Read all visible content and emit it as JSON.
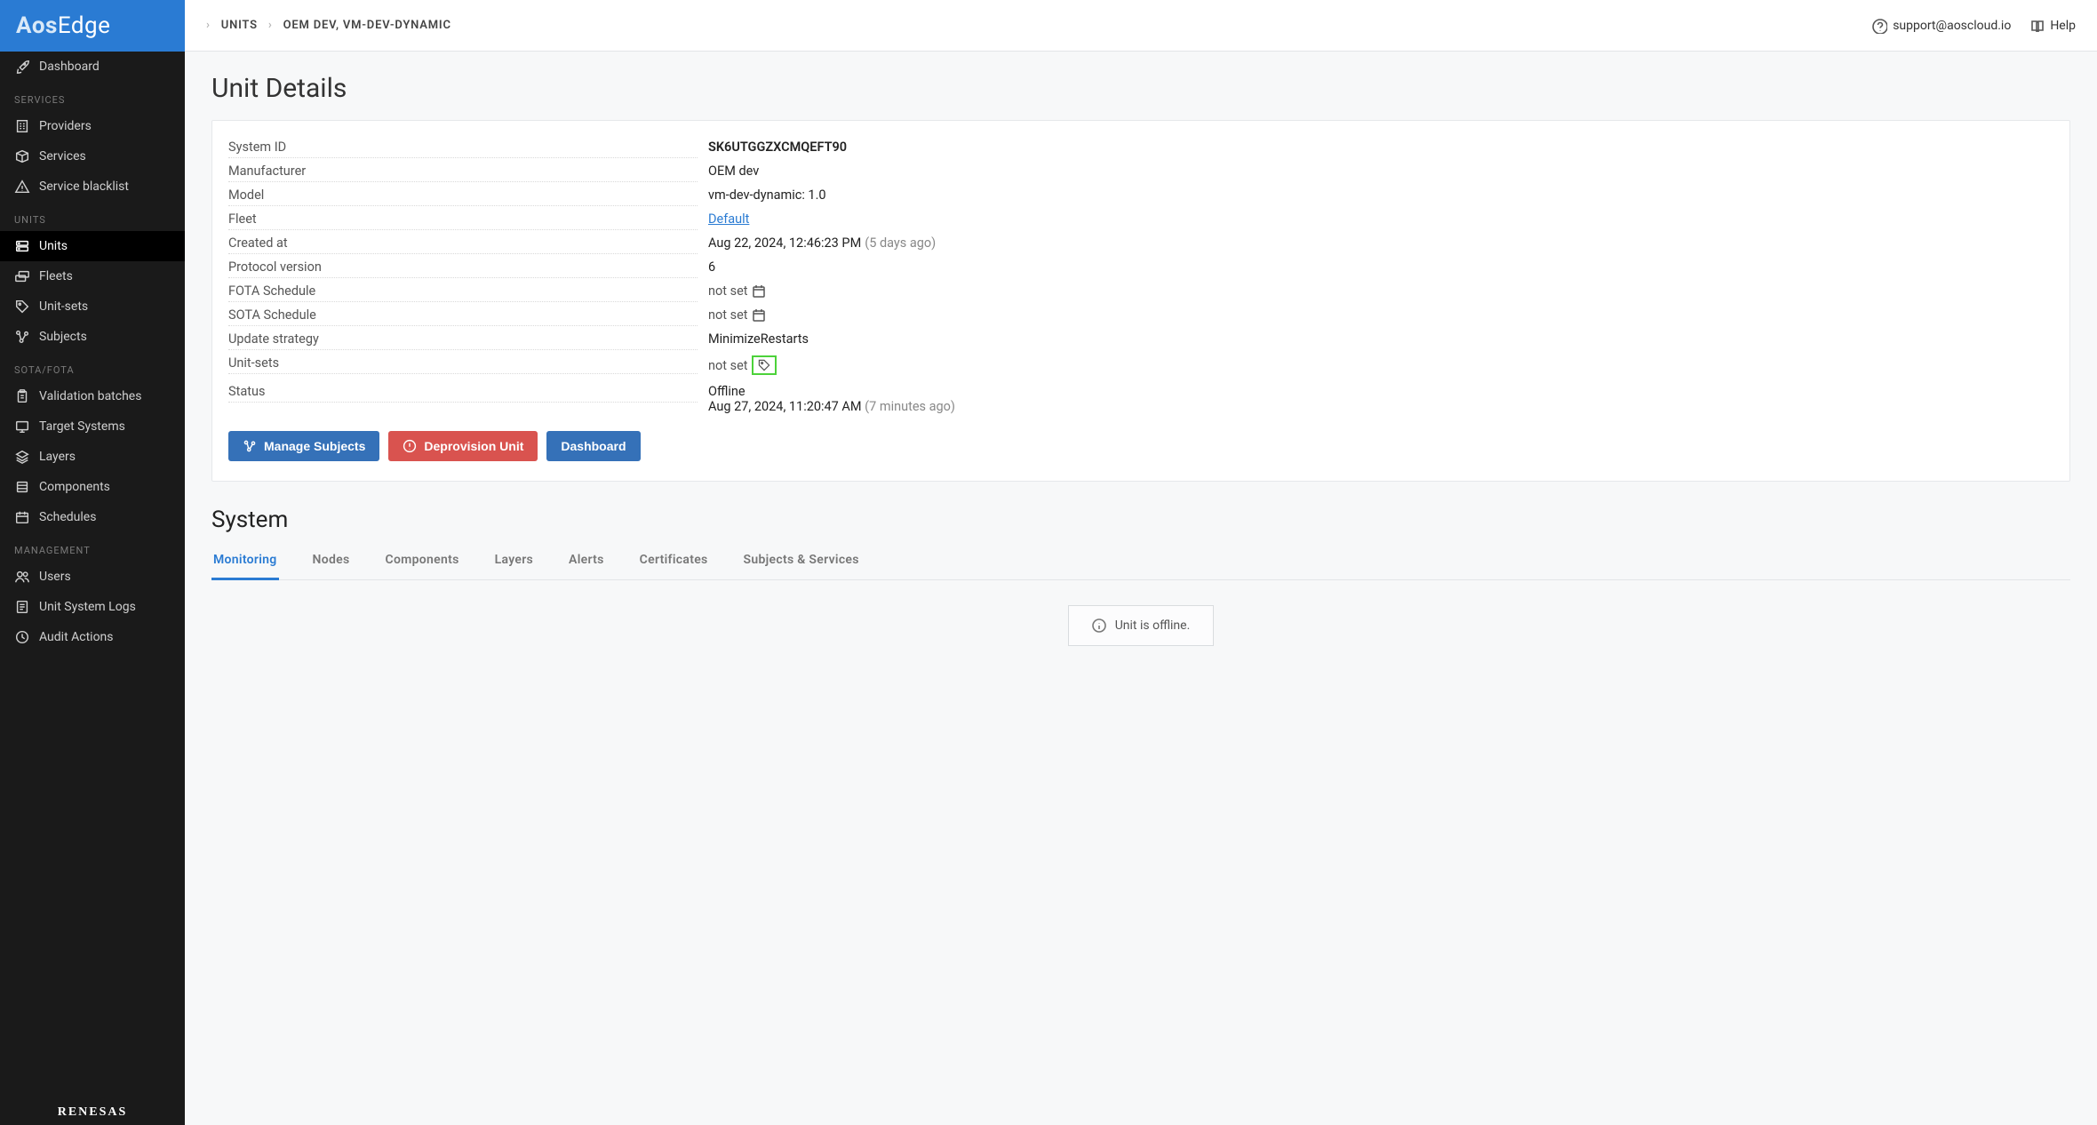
{
  "app": {
    "logo1": "Aos",
    "logo2": "Edge",
    "footer": "RENESAS"
  },
  "sidebar": {
    "top": [
      {
        "icon": "rocket",
        "label": "Dashboard"
      }
    ],
    "sections": [
      {
        "title": "SERVICES",
        "items": [
          {
            "icon": "building",
            "label": "Providers"
          },
          {
            "icon": "box",
            "label": "Services"
          },
          {
            "icon": "alert",
            "label": "Service blacklist"
          }
        ]
      },
      {
        "title": "UNITS",
        "items": [
          {
            "icon": "server",
            "label": "Units",
            "active": true
          },
          {
            "icon": "fleet",
            "label": "Fleets"
          },
          {
            "icon": "tag",
            "label": "Unit-sets"
          },
          {
            "icon": "graph",
            "label": "Subjects"
          }
        ]
      },
      {
        "title": "SOTA/FOTA",
        "items": [
          {
            "icon": "clipboard",
            "label": "Validation batches"
          },
          {
            "icon": "monitor",
            "label": "Target Systems"
          },
          {
            "icon": "layers",
            "label": "Layers"
          },
          {
            "icon": "component",
            "label": "Components"
          },
          {
            "icon": "calendar",
            "label": "Schedules"
          }
        ]
      },
      {
        "title": "MANAGEMENT",
        "items": [
          {
            "icon": "users",
            "label": "Users"
          },
          {
            "icon": "log",
            "label": "Unit System Logs"
          },
          {
            "icon": "audit",
            "label": "Audit Actions"
          }
        ]
      }
    ]
  },
  "topbar": {
    "crumb1": "UNITS",
    "crumb2": "OEM DEV, VM-DEV-DYNAMIC",
    "support": "support@aoscloud.io",
    "help": "Help"
  },
  "page": {
    "title": "Unit Details",
    "rows": {
      "system_id": {
        "label": "System ID",
        "value": "SK6UTGGZXCMQEFT90"
      },
      "manufacturer": {
        "label": "Manufacturer",
        "value": "OEM dev"
      },
      "model": {
        "label": "Model",
        "value": "vm-dev-dynamic: 1.0"
      },
      "fleet": {
        "label": "Fleet",
        "value": "Default"
      },
      "created": {
        "label": "Created at",
        "value": "Aug 22, 2024, 12:46:23 PM",
        "sub": "(5 days ago)"
      },
      "protocol": {
        "label": "Protocol version",
        "value": "6"
      },
      "fota": {
        "label": "FOTA Schedule",
        "value": "not set"
      },
      "sota": {
        "label": "SOTA Schedule",
        "value": "not set"
      },
      "strategy": {
        "label": "Update strategy",
        "value": "MinimizeRestarts"
      },
      "unitsets": {
        "label": "Unit-sets",
        "value": "not set"
      },
      "status": {
        "label": "Status",
        "value": "Offline",
        "line2": "Aug 27, 2024, 11:20:47 AM",
        "sub": "(7 minutes ago)"
      }
    },
    "buttons": {
      "manage": "Manage Subjects",
      "deprovision": "Deprovision Unit",
      "dashboard": "Dashboard"
    },
    "system_heading": "System",
    "tabs": [
      "Monitoring",
      "Nodes",
      "Components",
      "Layers",
      "Alerts",
      "Certificates",
      "Subjects & Services"
    ],
    "active_tab": 0,
    "banner": "Unit is offline."
  }
}
